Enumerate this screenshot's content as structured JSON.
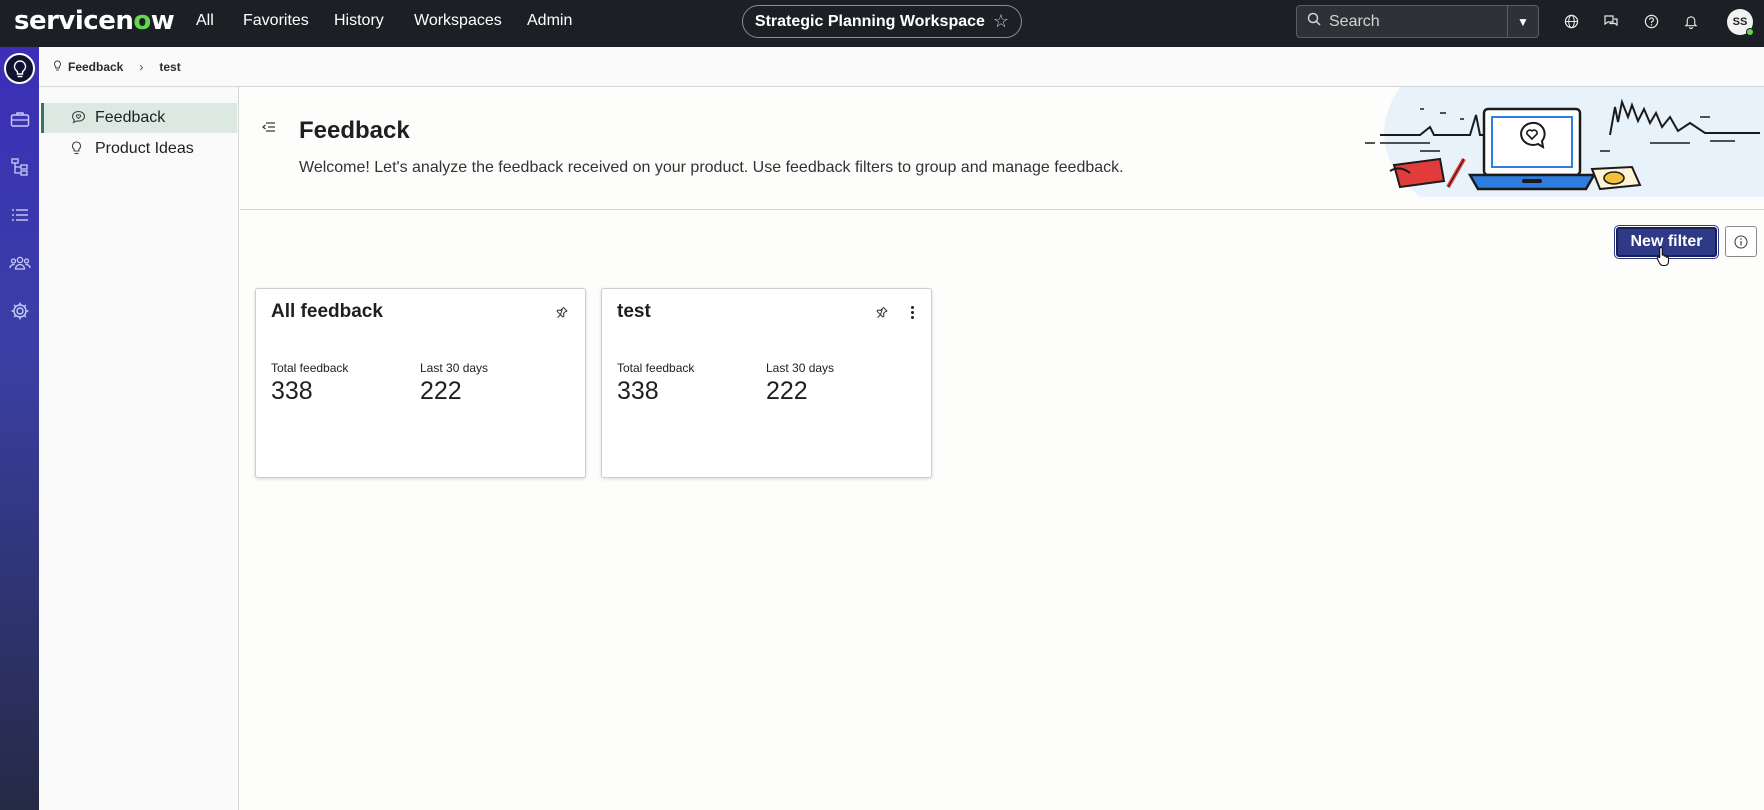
{
  "topbar": {
    "logo_prefix": "servicen",
    "logo_o": "o",
    "logo_suffix": "w",
    "nav": [
      "All",
      "Favorites",
      "History",
      "Workspaces",
      "Admin"
    ],
    "workspace": "Strategic Planning Workspace",
    "search_placeholder": "Search",
    "avatar_initials": "SS",
    "icons": [
      "globe-icon",
      "chat-icon",
      "help-icon",
      "bell-icon"
    ]
  },
  "rail": {
    "icons": [
      "lightbulb-icon",
      "briefcase-icon",
      "hierarchy-icon",
      "list-icon",
      "people-icon",
      "gear-icon"
    ]
  },
  "breadcrumb": {
    "items": [
      "Feedback",
      "test"
    ]
  },
  "sidebar": {
    "items": [
      {
        "label": "Feedback",
        "icon": "feedback-icon"
      },
      {
        "label": "Product Ideas",
        "icon": "lightbulb-icon"
      }
    ]
  },
  "header": {
    "title": "Feedback",
    "description": "Welcome! Let's analyze the feedback received on your product. Use feedback filters to group and manage feedback."
  },
  "toolbar": {
    "new_filter_label": "New filter"
  },
  "cards": [
    {
      "title": "All feedback",
      "total_label": "Total feedback",
      "total_value": "338",
      "recent_label": "Last 30 days",
      "recent_value": "222"
    },
    {
      "title": "test",
      "total_label": "Total feedback",
      "total_value": "338",
      "recent_label": "Last 30 days",
      "recent_value": "222"
    }
  ],
  "colors": {
    "topbar_bg": "#1c1f24",
    "primary_button": "#2e3a86",
    "brand_green": "#62d84e",
    "active_nav_bg": "#dce9e3"
  }
}
